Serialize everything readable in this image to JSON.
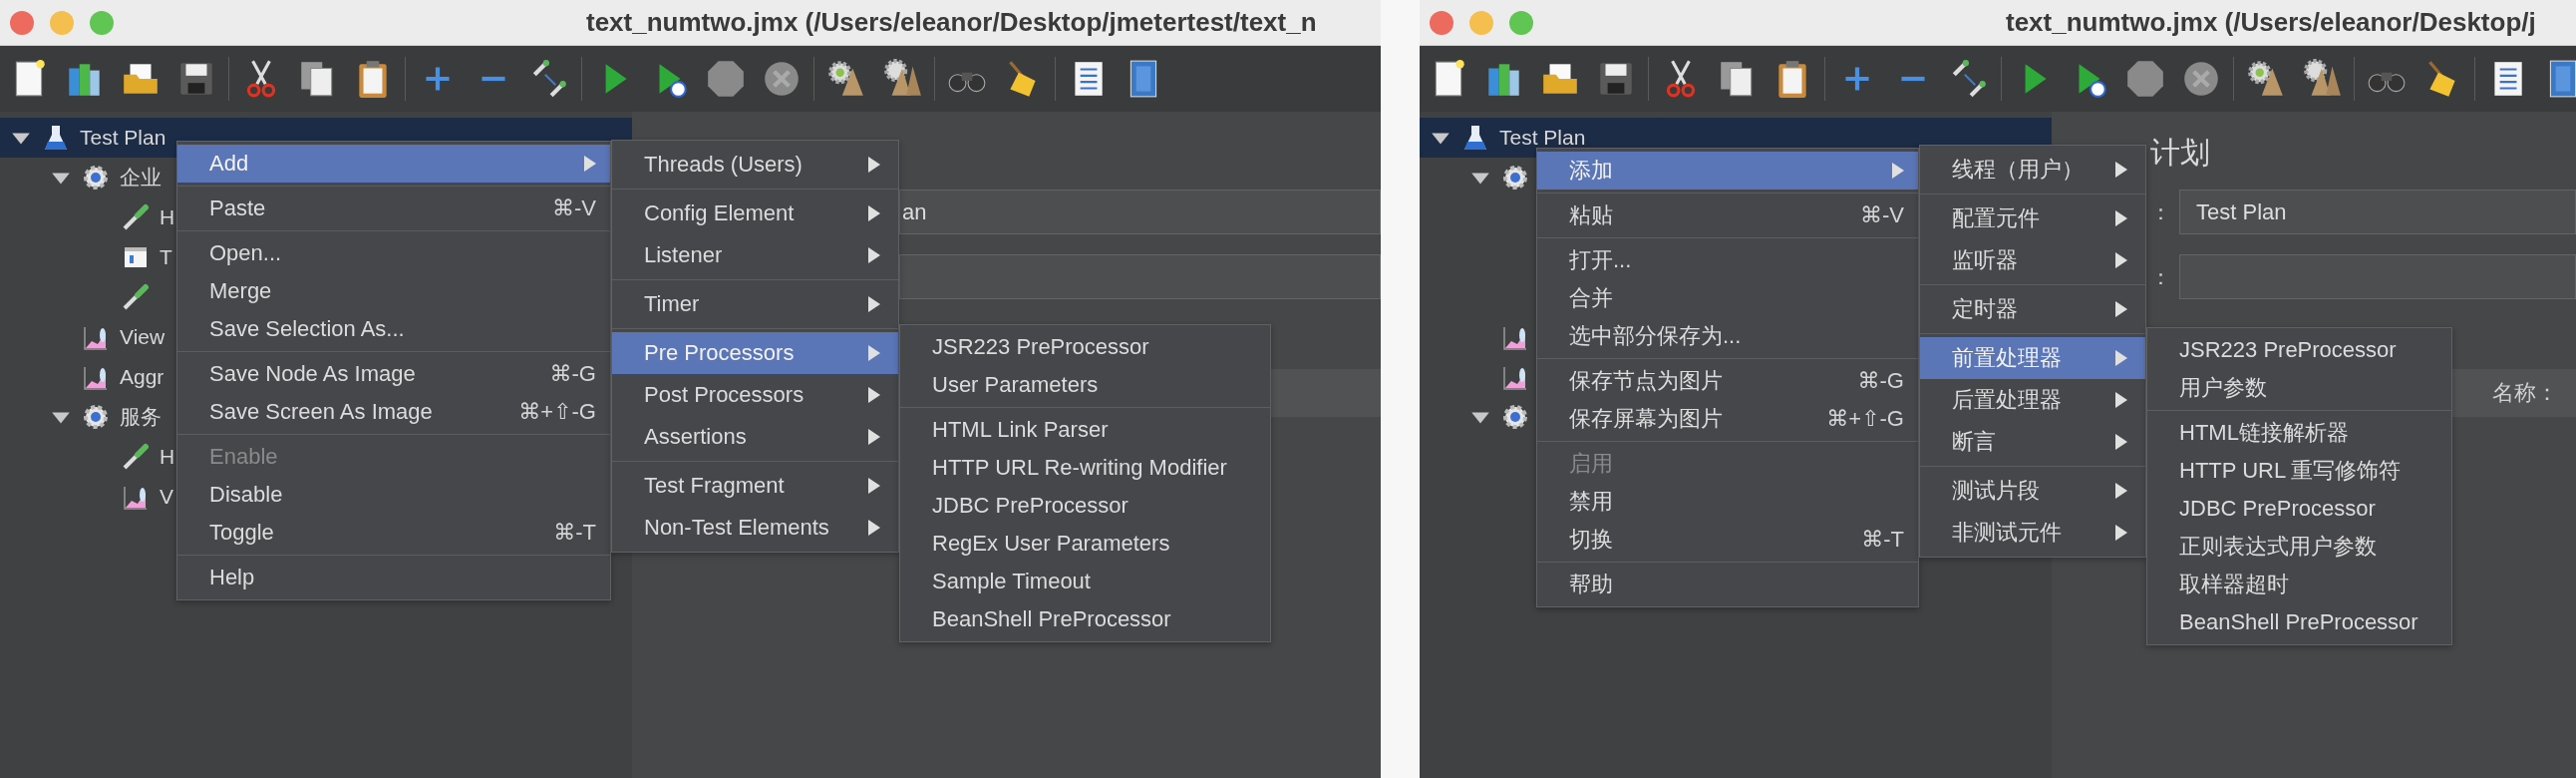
{
  "windows": [
    {
      "title": "text_numtwo.jmx (/Users/eleanor/Desktop/jmetertest/text_n",
      "tree": [
        {
          "label": "Test Plan",
          "kind": "plan",
          "expanded": true,
          "selected": true,
          "children": [
            {
              "label": "企业",
              "kind": "thread-group",
              "expanded": true,
              "selected": false,
              "children": [
                {
                  "label": "H",
                  "kind": "sampler",
                  "selected": false
                },
                {
                  "label": "T",
                  "kind": "config",
                  "selected": false
                },
                {
                  "kind": "sampler",
                  "selected": false
                }
              ]
            },
            {
              "label": "View",
              "kind": "listener",
              "selected": false
            },
            {
              "label": "Aggr",
              "kind": "listener",
              "selected": false
            },
            {
              "label": "服务",
              "kind": "thread-group",
              "expanded": true,
              "selected": false,
              "children": [
                {
                  "label": "H",
                  "kind": "sampler",
                  "selected": false
                },
                {
                  "label": "V",
                  "kind": "listener",
                  "selected": false
                }
              ]
            }
          ]
        }
      ],
      "details": {
        "fields": [
          {
            "kind": "text",
            "value": "an"
          },
          {
            "kind": "text"
          }
        ]
      },
      "menus": [
        {
          "groups": [
            [
              {
                "label": "Add",
                "selected": true,
                "disabled": false,
                "submenu": true
              }
            ],
            [
              {
                "label": "Paste",
                "shortcut": "⌘-V",
                "selected": false,
                "disabled": false,
                "submenu": false
              }
            ],
            [
              {
                "label": "Open...",
                "selected": false,
                "disabled": false,
                "submenu": false
              },
              {
                "label": "Merge",
                "selected": false,
                "disabled": false,
                "submenu": false
              },
              {
                "label": "Save Selection As...",
                "selected": false,
                "disabled": false,
                "submenu": false
              }
            ],
            [
              {
                "label": "Save Node As Image",
                "shortcut": "⌘-G",
                "selected": false,
                "disabled": false,
                "submenu": false
              },
              {
                "label": "Save Screen As Image",
                "shortcut": "⌘+⇧-G",
                "selected": false,
                "disabled": false,
                "submenu": false
              }
            ],
            [
              {
                "label": "Enable",
                "selected": false,
                "disabled": true,
                "submenu": false
              },
              {
                "label": "Disable",
                "selected": false,
                "disabled": false,
                "submenu": false
              },
              {
                "label": "Toggle",
                "shortcut": "⌘-T",
                "selected": false,
                "disabled": false,
                "submenu": false
              }
            ],
            [
              {
                "label": "Help",
                "selected": false,
                "disabled": false,
                "submenu": false
              }
            ]
          ]
        },
        {
          "groups": [
            [
              {
                "label": "Threads (Users)",
                "selected": false,
                "submenu": true
              }
            ],
            [
              {
                "label": "Config Element",
                "selected": false,
                "submenu": true
              },
              {
                "label": "Listener",
                "selected": false,
                "submenu": true
              }
            ],
            [
              {
                "label": "Timer",
                "selected": false,
                "submenu": true
              }
            ],
            [
              {
                "label": "Pre Processors",
                "selected": true,
                "submenu": true
              },
              {
                "label": "Post Processors",
                "selected": false,
                "submenu": true
              },
              {
                "label": "Assertions",
                "selected": false,
                "submenu": true
              }
            ],
            [
              {
                "label": "Test Fragment",
                "selected": false,
                "submenu": true
              },
              {
                "label": "Non-Test Elements",
                "selected": false,
                "submenu": true
              }
            ]
          ]
        },
        {
          "groups": [
            [
              {
                "label": "JSR223 PreProcessor",
                "selected": false,
                "submenu": false
              },
              {
                "label": "User Parameters",
                "selected": false,
                "submenu": false
              }
            ],
            [
              {
                "label": "HTML Link Parser",
                "selected": false,
                "submenu": false
              },
              {
                "label": "HTTP URL Re-writing Modifier",
                "selected": false,
                "submenu": false
              },
              {
                "label": "JDBC PreProcessor",
                "selected": false,
                "submenu": false
              },
              {
                "label": "RegEx User Parameters",
                "selected": false,
                "submenu": false
              },
              {
                "label": "Sample Timeout",
                "selected": false,
                "submenu": false
              },
              {
                "label": "BeanShell PreProcessor",
                "selected": false,
                "submenu": false
              }
            ]
          ]
        }
      ]
    },
    {
      "title": "text_numtwo.jmx (/Users/eleanor/Desktop/j",
      "tree": [
        {
          "label": "Test Plan",
          "kind": "plan",
          "expanded": true,
          "selected": true,
          "children": [
            {
              "kind": "thread-group",
              "expanded": true,
              "selected": false,
              "children": [
                {
                  "selected": false
                },
                {
                  "selected": false
                },
                {
                  "selected": false
                }
              ]
            },
            {
              "kind": "listener",
              "selected": false
            },
            {
              "kind": "listener",
              "selected": false
            },
            {
              "kind": "thread-group",
              "expanded": true,
              "selected": false,
              "children": [
                {
                  "selected": false
                },
                {
                  "selected": false
                }
              ]
            }
          ]
        }
      ],
      "details": {
        "heading": "计划",
        "fields": [
          {
            "kind": "text",
            "label": "：",
            "value": "Test Plan"
          },
          {
            "kind": "text",
            "label": "："
          }
        ],
        "bar_label": "名称："
      },
      "menus": [
        {
          "groups": [
            [
              {
                "label": "添加",
                "selected": true,
                "disabled": false,
                "submenu": true
              }
            ],
            [
              {
                "label": "粘贴",
                "shortcut": "⌘-V",
                "selected": false,
                "disabled": false,
                "submenu": false
              }
            ],
            [
              {
                "label": "打开...",
                "selected": false,
                "disabled": false,
                "submenu": false
              },
              {
                "label": "合并",
                "selected": false,
                "disabled": false,
                "submenu": false
              },
              {
                "label": "选中部分保存为...",
                "selected": false,
                "disabled": false,
                "submenu": false
              }
            ],
            [
              {
                "label": "保存节点为图片",
                "shortcut": "⌘-G",
                "selected": false,
                "disabled": false,
                "submenu": false
              },
              {
                "label": "保存屏幕为图片",
                "shortcut": "⌘+⇧-G",
                "selected": false,
                "disabled": false,
                "submenu": false
              }
            ],
            [
              {
                "label": "启用",
                "selected": false,
                "disabled": true,
                "submenu": false
              },
              {
                "label": "禁用",
                "selected": false,
                "disabled": false,
                "submenu": false
              },
              {
                "label": "切换",
                "shortcut": "⌘-T",
                "selected": false,
                "disabled": false,
                "submenu": false
              }
            ],
            [
              {
                "label": "帮助",
                "selected": false,
                "disabled": false,
                "submenu": false
              }
            ]
          ]
        },
        {
          "groups": [
            [
              {
                "label": "线程（用户）",
                "selected": false,
                "submenu": true
              }
            ],
            [
              {
                "label": "配置元件",
                "selected": false,
                "submenu": true
              },
              {
                "label": "监听器",
                "selected": false,
                "submenu": true
              }
            ],
            [
              {
                "label": "定时器",
                "selected": false,
                "submenu": true
              }
            ],
            [
              {
                "label": "前置处理器",
                "selected": true,
                "submenu": true
              },
              {
                "label": "后置处理器",
                "selected": false,
                "submenu": true
              },
              {
                "label": "断言",
                "selected": false,
                "submenu": true
              }
            ],
            [
              {
                "label": "测试片段",
                "selected": false,
                "submenu": true
              },
              {
                "label": "非测试元件",
                "selected": false,
                "submenu": true
              }
            ]
          ]
        },
        {
          "groups": [
            [
              {
                "label": "JSR223 PreProcessor",
                "selected": false,
                "submenu": false
              },
              {
                "label": "用户参数",
                "selected": false,
                "submenu": false
              }
            ],
            [
              {
                "label": "HTML链接解析器",
                "selected": false,
                "submenu": false
              },
              {
                "label": "HTTP URL 重写修饰符",
                "selected": false,
                "submenu": false
              },
              {
                "label": "JDBC PreProcessor",
                "selected": false,
                "submenu": false
              },
              {
                "label": "正则表达式用户参数",
                "selected": false,
                "submenu": false
              },
              {
                "label": "取样器超时",
                "selected": false,
                "submenu": false
              },
              {
                "label": "BeanShell PreProcessor",
                "selected": false,
                "submenu": false
              }
            ]
          ]
        }
      ]
    }
  ]
}
